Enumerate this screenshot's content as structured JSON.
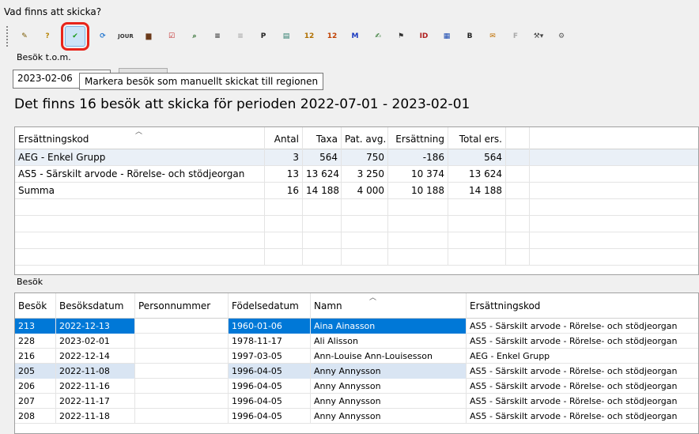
{
  "window": {
    "title": "Vad finns att skicka?"
  },
  "toolbar": {
    "buttons": [
      {
        "name": "open-folder-icon",
        "glyph": "✎",
        "color": "#7a5a00"
      },
      {
        "name": "help-icon",
        "glyph": "?",
        "color": "#b8860b"
      },
      {
        "name": "mark-sent-icon",
        "glyph": "✔",
        "color": "#1a9a1a"
      },
      {
        "name": "refresh-icon",
        "glyph": "⟳",
        "color": "#2a7ad0"
      },
      {
        "name": "journal-icon",
        "glyph": "JOUR",
        "color": "#333"
      },
      {
        "name": "briefcase-icon",
        "glyph": "▆",
        "color": "#6b3a1a"
      },
      {
        "name": "edit-checkbox-icon",
        "glyph": "☑",
        "color": "#c02020"
      },
      {
        "name": "visit-search-icon",
        "glyph": "⌕",
        "color": "#2a6a2a"
      },
      {
        "name": "visit-list-icon",
        "glyph": "≡",
        "color": "#333"
      },
      {
        "name": "visit-list-disabled-icon",
        "glyph": "≡",
        "color": "#aaa"
      },
      {
        "name": "p-icon",
        "glyph": "P",
        "color": "#222"
      },
      {
        "name": "notes-icon",
        "glyph": "▤",
        "color": "#2a7a6a"
      },
      {
        "name": "calendar-12-icon",
        "glyph": "12",
        "color": "#b07000"
      },
      {
        "name": "calendar-12b-icon",
        "glyph": "12",
        "color": "#c04000"
      },
      {
        "name": "m-icon",
        "glyph": "M",
        "color": "#1a3ac0"
      },
      {
        "name": "pen-tablet-icon",
        "glyph": "✍",
        "color": "#1a6a1a"
      },
      {
        "name": "stamp-icon",
        "glyph": "⚑",
        "color": "#333"
      },
      {
        "name": "id-icon",
        "glyph": "ID",
        "color": "#b02020"
      },
      {
        "name": "form-icon",
        "glyph": "▦",
        "color": "#1a4ab0"
      },
      {
        "name": "b-icon",
        "glyph": "B",
        "color": "#222"
      },
      {
        "name": "envelope-icon",
        "glyph": "✉",
        "color": "#c07000"
      },
      {
        "name": "f-disabled-icon",
        "glyph": "F",
        "color": "#aaa"
      },
      {
        "name": "tools-dropdown-icon",
        "glyph": "⚒▾",
        "color": "#444"
      },
      {
        "name": "settings-gear-icon",
        "glyph": "⚙",
        "color": "#5a5a5a"
      }
    ]
  },
  "filter": {
    "label": "Besök t.o.m.",
    "date_value": "2023-02-06"
  },
  "tooltip": {
    "text": "Markera besök som manuellt skickat till regionen"
  },
  "summary_heading": "Det finns 16 besök att skicka för perioden 2022-07-01 - 2023-02-01",
  "summary_table": {
    "columns": [
      "Ersättningskod",
      "Antal",
      "Taxa",
      "Pat. avg.",
      "Ersättning",
      "Total ers."
    ],
    "rows": [
      [
        "AEG - Enkel Grupp",
        "3",
        "564",
        "750",
        "-186",
        "564"
      ],
      [
        "AS5 - Särskilt arvode - Rörelse- och stödjeorgan",
        "13",
        "13 624",
        "3 250",
        "10 374",
        "13 624"
      ],
      [
        "Summa",
        "16",
        "14 188",
        "4 000",
        "10 188",
        "14 188"
      ]
    ]
  },
  "visits": {
    "label": "Besök",
    "columns": [
      "Besök",
      "Besöksdatum",
      "Personnummer",
      "Födelsedatum",
      "Namn",
      "Ersättningskod"
    ],
    "rows": [
      [
        "213",
        "2022-12-13",
        "",
        "1960-01-06",
        "Aina Ainasson",
        "AS5 - Särskilt arvode - Rörelse- och stödjeorgan"
      ],
      [
        "228",
        "2023-02-01",
        "",
        "1978-11-17",
        "Ali Alisson",
        "AS5 - Särskilt arvode - Rörelse- och stödjeorgan"
      ],
      [
        "216",
        "2022-12-14",
        "",
        "1997-03-05",
        "Ann-Louise Ann-Louisesson",
        "AEG - Enkel Grupp"
      ],
      [
        "205",
        "2022-11-08",
        "",
        "1996-04-05",
        "Anny Annysson",
        "AS5 - Särskilt arvode - Rörelse- och stödjeorgan"
      ],
      [
        "206",
        "2022-11-16",
        "",
        "1996-04-05",
        "Anny Annysson",
        "AS5 - Särskilt arvode - Rörelse- och stödjeorgan"
      ],
      [
        "207",
        "2022-11-17",
        "",
        "1996-04-05",
        "Anny Annysson",
        "AS5 - Särskilt arvode - Rörelse- och stödjeorgan"
      ],
      [
        "208",
        "2022-11-18",
        "",
        "1996-04-05",
        "Anny Annysson",
        "AS5 - Särskilt arvode - Rörelse- och stödjeorgan"
      ]
    ]
  },
  "colors": {
    "selection": "#0078d7",
    "alt_highlight": "#d9e5f3",
    "callout": "#e8241a"
  }
}
